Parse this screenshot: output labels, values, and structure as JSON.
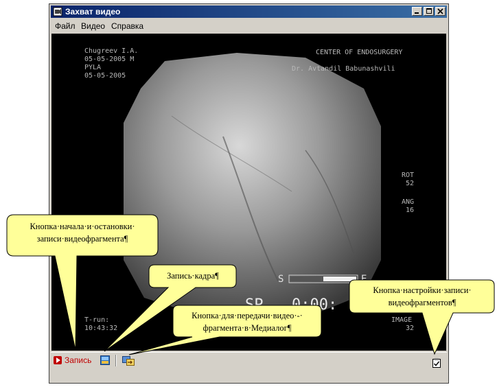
{
  "window": {
    "title": "Захват видео"
  },
  "menu": [
    {
      "label": "Файл"
    },
    {
      "label": "Видео"
    },
    {
      "label": "Справка"
    }
  ],
  "video_overlay": {
    "patient_name": "Chugreev I.A.",
    "date_sex": "05-05-2005  M",
    "site": "PYLA",
    "date": "05-05-2005",
    "center": "CENTER OF ENDOSURGERY",
    "doctor": "Dr. Avtandil Babunashvili",
    "rot_label": "ROT",
    "rot_value": "52",
    "ang_label": "ANG",
    "ang_value": "16",
    "s_label": "S",
    "e_label": "E",
    "sp_label": "SP",
    "timer": "0:00:",
    "trun_label": "T-run:",
    "trun_value": "10:43:32",
    "image_label": "IMAGE",
    "image_value": "32"
  },
  "toolbar": {
    "record_label": "Запись"
  },
  "callouts": {
    "record": "Кнопка·начала·и·остановки· записи·видеофрагмента¶",
    "frame": "Запись·кадра¶",
    "send": "Кнопка·для·передачи·видео·-· фрагмента·в·Медиалог¶",
    "settings": "Кнопка·настройки·записи· видеофрагментов¶"
  },
  "colors": {
    "titlebar_start": "#0a246a",
    "titlebar_end": "#3a6ea5",
    "callout_fill": "#ffff99",
    "record_red": "#c00000"
  }
}
